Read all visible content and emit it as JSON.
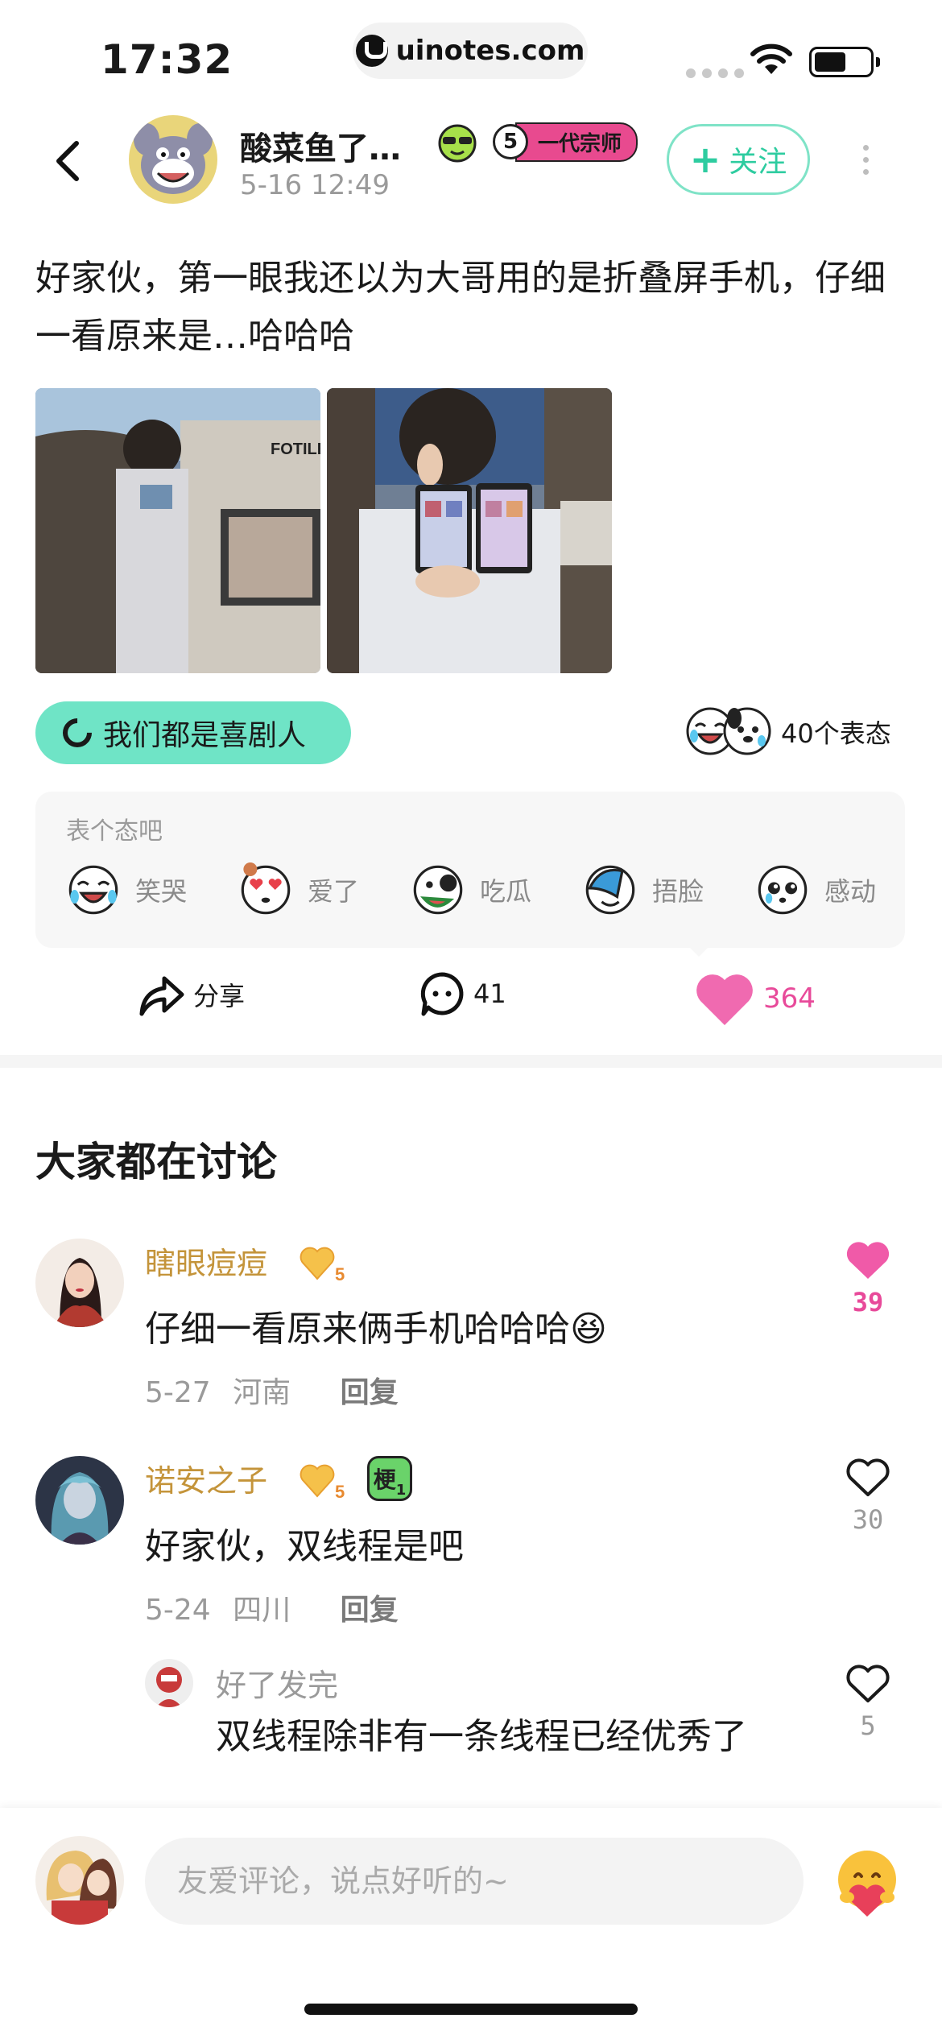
{
  "status_bar": {
    "time": "17:32",
    "url": "uinotes.com"
  },
  "header": {
    "author_name": "酸菜鱼了…",
    "post_time": "5-16 12:49",
    "rank_number": "5",
    "rank_label": "一代宗师",
    "follow_label": "关注"
  },
  "post": {
    "text": "好家伙，第一眼我还以为大哥用的是折叠屏手机，仔细一看原来是…哈哈哈",
    "photo_1_sign": "FOTILE",
    "topic_label": "我们都是喜剧人",
    "reaction_count": "40个表态"
  },
  "react_panel": {
    "prompt": "表个态吧",
    "options": [
      {
        "label": "笑哭"
      },
      {
        "label": "爱了"
      },
      {
        "label": "吃瓜"
      },
      {
        "label": "捂脸"
      },
      {
        "label": "感动"
      }
    ]
  },
  "actions": {
    "share_label": "分享",
    "comment_count": "41",
    "like_count": "364"
  },
  "comments_section": {
    "title": "大家都在讨论",
    "items": [
      {
        "name": "瞎眼痘痘",
        "level": "5",
        "text": "仔细一看原来俩手机哈哈哈😆",
        "date": "5-27",
        "location": "河南",
        "reply_label": "回复",
        "likes": "39",
        "liked": true
      },
      {
        "name": "诺安之子",
        "level": "5",
        "meme_badge": "梗",
        "meme_level": "1",
        "text": "好家伙，双线程是吧",
        "date": "5-24",
        "location": "四川",
        "reply_label": "回复",
        "likes": "30",
        "liked": false
      }
    ],
    "reply": {
      "name": "好了发完",
      "text": "双线程除非有一条线程已经优秀了",
      "likes": "5"
    }
  },
  "bottom_bar": {
    "input_placeholder": "友爱评论，说点好听的~"
  },
  "colors": {
    "accent_green": "#6fe4c6",
    "like_pink": "#e84a9a",
    "username_gold": "#c4943a"
  }
}
